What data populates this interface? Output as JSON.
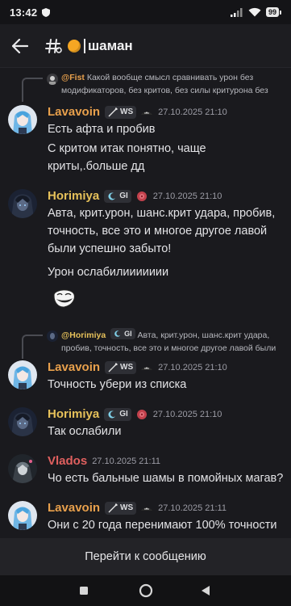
{
  "status_bar": {
    "time": "13:42",
    "battery": "99"
  },
  "header": {
    "title": "шаман"
  },
  "colors": {
    "lavavoin": "#e8a04c",
    "horimiya": "#e6c15a",
    "vlados": "#e0605f",
    "fist": "#e8a04c",
    "channel_dot": "#f5a623"
  },
  "replies": [
    {
      "name": "@Fist",
      "text": "Какой вообще смысл сравнивать урон без модификаторов, без критов, без силы критурона без"
    },
    {
      "name": "@Horimiya",
      "tag": "GI",
      "text": "Авта, крит.урон, шанс.крит удара, пробив, точность, все это и многое другое лавой были"
    }
  ],
  "messages": [
    {
      "author": "Lavavoin",
      "tag": "WS",
      "timestamp": "27.10.2025 21:10",
      "lines": [
        "Есть афта и пробив",
        "С критом итак понятно, чаще",
        "криты,.больше дд"
      ]
    },
    {
      "author": "Horimiya",
      "tag": "GI",
      "timestamp": "27.10.2025 21:10",
      "lines": [
        "Авта, крит.урон, шанс.крит удара, пробив,",
        "точность, все это и многое другое лавой",
        "были успешно забыто!",
        "Урон ослабилиииииии"
      ]
    },
    {
      "author": "Lavavoin",
      "tag": "WS",
      "timestamp": "27.10.2025 21:10",
      "lines": [
        "Точность убери из списка"
      ]
    },
    {
      "author": "Horimiya",
      "tag": "GI",
      "timestamp": "27.10.2025 21:10",
      "lines": [
        "Так ослабили"
      ]
    },
    {
      "author": "Vlados",
      "timestamp": "27.10.2025 21:11",
      "lines": [
        "Чо есть бальные шамы в помойных магав?"
      ]
    },
    {
      "author": "Lavavoin",
      "tag": "WS",
      "timestamp": "27.10.2025 21:11",
      "lines": [
        "Они с 20 года перенимают 100% точности"
      ]
    }
  ],
  "jump_bar": {
    "label": "Перейти к сообщению"
  }
}
